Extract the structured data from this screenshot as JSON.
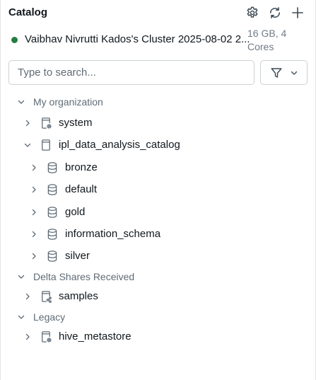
{
  "header": {
    "title": "Catalog",
    "actions": [
      {
        "icon": "gear-icon"
      },
      {
        "icon": "refresh-icon"
      },
      {
        "icon": "plus-icon"
      }
    ]
  },
  "cluster": {
    "name": "Vaibhav Nivrutti Kados's Cluster 2025-08-02 2...",
    "meta": "16 GB, 4 Cores",
    "status_color": "#277c43"
  },
  "search": {
    "placeholder": "Type to search...",
    "value": ""
  },
  "tree": {
    "sections": [
      {
        "label": "My organization",
        "expanded": true,
        "nodes": [
          {
            "label": "system",
            "icon": "catalog-gear-icon",
            "expanded": false
          },
          {
            "label": "ipl_data_analysis_catalog",
            "icon": "catalog-icon",
            "expanded": true,
            "children": [
              {
                "label": "bronze",
                "icon": "database-icon"
              },
              {
                "label": "default",
                "icon": "database-icon"
              },
              {
                "label": "gold",
                "icon": "database-icon"
              },
              {
                "label": "information_schema",
                "icon": "database-icon"
              },
              {
                "label": "silver",
                "icon": "database-icon"
              }
            ]
          }
        ]
      },
      {
        "label": "Delta Shares Received",
        "expanded": true,
        "nodes": [
          {
            "label": "samples",
            "icon": "catalog-share-icon",
            "expanded": false
          }
        ]
      },
      {
        "label": "Legacy",
        "expanded": true,
        "nodes": [
          {
            "label": "hive_metastore",
            "icon": "catalog-gear-icon",
            "expanded": false
          }
        ]
      }
    ]
  }
}
